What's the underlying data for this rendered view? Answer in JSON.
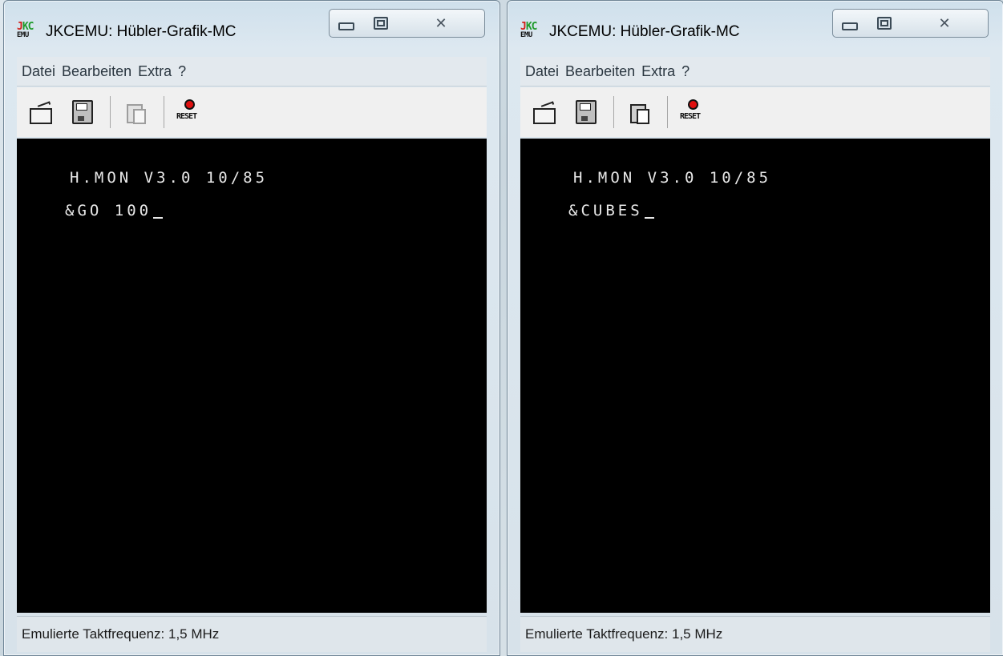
{
  "windows": [
    {
      "title": "JKCEMU: Hübler-Grafik-MC",
      "icon": {
        "jk_j": "J",
        "jk_kc": "KC",
        "emu": "EMU"
      },
      "menu": [
        "Datei",
        "Bearbeiten",
        "Extra",
        "?"
      ],
      "toolbar": {
        "reset_label": "RESET",
        "paste_enabled": false
      },
      "screen": {
        "line1": "H.MON V3.0 10/85",
        "line2": "&GO 100"
      },
      "status": "Emulierte Taktfrequenz: 1,5 MHz"
    },
    {
      "title": "JKCEMU: Hübler-Grafik-MC",
      "icon": {
        "jk_j": "J",
        "jk_kc": "KC",
        "emu": "EMU"
      },
      "menu": [
        "Datei",
        "Bearbeiten",
        "Extra",
        "?"
      ],
      "toolbar": {
        "reset_label": "RESET",
        "paste_enabled": true
      },
      "screen": {
        "line1": "H.MON V3.0 10/85",
        "line2": "&CUBES"
      },
      "status": "Emulierte Taktfrequenz: 1,5 MHz"
    }
  ],
  "colors": {
    "screen_bg": "#000000",
    "screen_fg": "#e8e8e8",
    "reset_dot": "#e01010"
  }
}
